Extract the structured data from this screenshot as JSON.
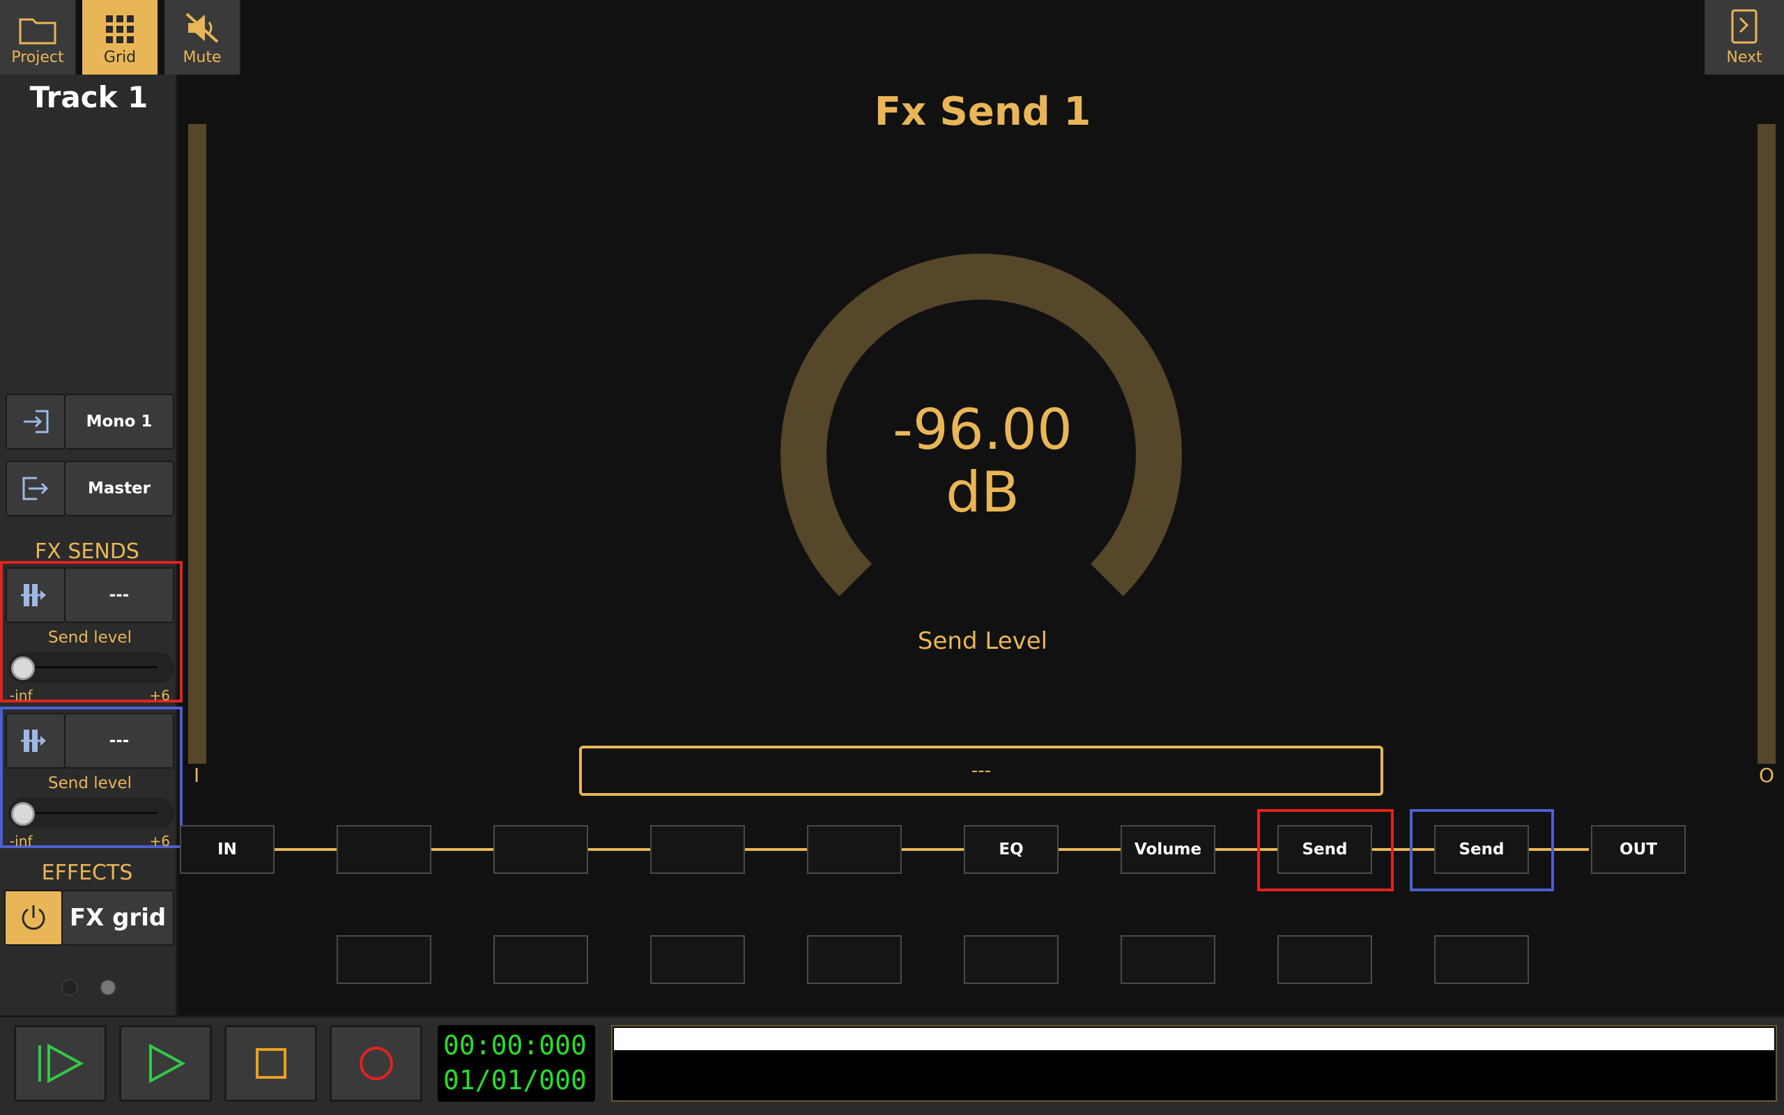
{
  "toolbar": {
    "project": "Project",
    "grid": "Grid",
    "mute": "Mute",
    "next": "Next"
  },
  "sidebar": {
    "track_title": "Track 1",
    "input_name": "Mono 1",
    "output_name": "Master",
    "fx_sends_heading": "FX SENDS",
    "sends": [
      {
        "target": "---",
        "label": "Send level",
        "min": "-inf",
        "max": "+6",
        "level_fraction": 0.0
      },
      {
        "target": "---",
        "label": "Send level",
        "min": "-inf",
        "max": "+6",
        "level_fraction": 0.0
      }
    ],
    "effects_heading": "EFFECTS",
    "fx_grid_label": "FX grid"
  },
  "main": {
    "title": "Fx Send 1",
    "value": "-96.00",
    "unit": "dB",
    "knob_label": "Send Level",
    "knob_fraction": 0.0,
    "destination": "---",
    "left_meter_label": "I",
    "right_meter_label": "O"
  },
  "chain": {
    "slots": [
      "IN",
      "",
      "",
      "",
      "",
      "EQ",
      "Volume",
      "Send",
      "Send",
      "OUT"
    ],
    "lower_slots": [
      "",
      "",
      "",
      "",
      "",
      "",
      "",
      ""
    ]
  },
  "transport": {
    "time": "00:00:000",
    "position": "01/01/000"
  },
  "colors": {
    "accent": "#e9b657",
    "knob_track": "#56462a",
    "highlight_red": "#e1231f",
    "highlight_blue": "#4d5fd0",
    "timecode": "#2bdc2b"
  }
}
